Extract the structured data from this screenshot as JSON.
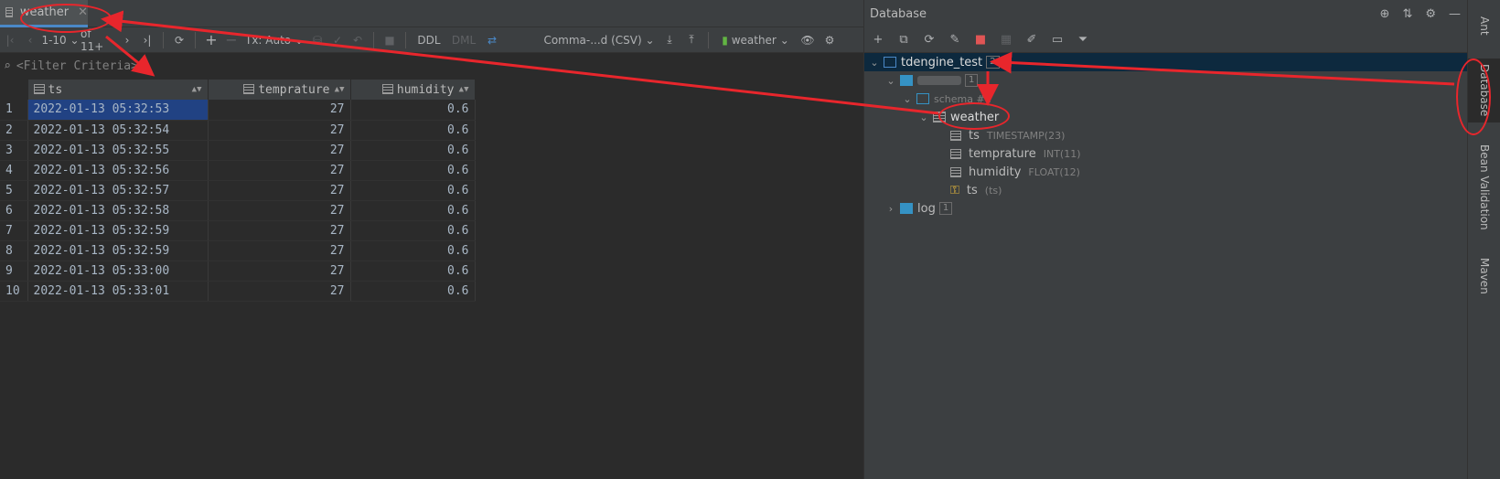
{
  "editor": {
    "tab_label": "weather",
    "toolbar": {
      "page_range": "1-10",
      "page_of": "of 11+",
      "tx_mode": "Tx: Auto",
      "ddl": "DDL",
      "dml": "DML",
      "export_format": "Comma-...d (CSV)",
      "table_selector": "weather"
    },
    "filter_placeholder": "<Filter Criteria>",
    "columns": [
      "ts",
      "temprature",
      "humidity"
    ],
    "rows": [
      {
        "n": "1",
        "ts": "2022-01-13 05:32:53",
        "t": "27",
        "h": "0.6"
      },
      {
        "n": "2",
        "ts": "2022-01-13 05:32:54",
        "t": "27",
        "h": "0.6"
      },
      {
        "n": "3",
        "ts": "2022-01-13 05:32:55",
        "t": "27",
        "h": "0.6"
      },
      {
        "n": "4",
        "ts": "2022-01-13 05:32:56",
        "t": "27",
        "h": "0.6"
      },
      {
        "n": "5",
        "ts": "2022-01-13 05:32:57",
        "t": "27",
        "h": "0.6"
      },
      {
        "n": "6",
        "ts": "2022-01-13 05:32:58",
        "t": "27",
        "h": "0.6"
      },
      {
        "n": "7",
        "ts": "2022-01-13 05:32:59",
        "t": "27",
        "h": "0.6"
      },
      {
        "n": "8",
        "ts": "2022-01-13 05:32:59",
        "t": "27",
        "h": "0.6"
      },
      {
        "n": "9",
        "ts": "2022-01-13 05:33:00",
        "t": "27",
        "h": "0.6"
      },
      {
        "n": "10",
        "ts": "2022-01-13 05:33:01",
        "t": "27",
        "h": "0.6"
      }
    ]
  },
  "database_panel": {
    "title": "Database",
    "tree": {
      "datasource": {
        "label": "tdengine_test",
        "count": "2"
      },
      "database": {
        "count": "1"
      },
      "schema": {
        "label": "schema #1"
      },
      "table": {
        "label": "weather"
      },
      "columns": [
        {
          "name": "ts",
          "type": "TIMESTAMP(23)"
        },
        {
          "name": "temprature",
          "type": "INT(11)"
        },
        {
          "name": "humidity",
          "type": "FLOAT(12)"
        }
      ],
      "key": {
        "name": "ts",
        "cols": "(ts)"
      },
      "log": {
        "label": "log",
        "count": "1"
      }
    }
  },
  "side_tabs": [
    "Ant",
    "Database",
    "Bean Validation",
    "Maven"
  ],
  "colors": {
    "selection": "#214283",
    "tree_selection": "#0d293e",
    "annotation": "#e8262c",
    "accent": "#4a88c7"
  }
}
